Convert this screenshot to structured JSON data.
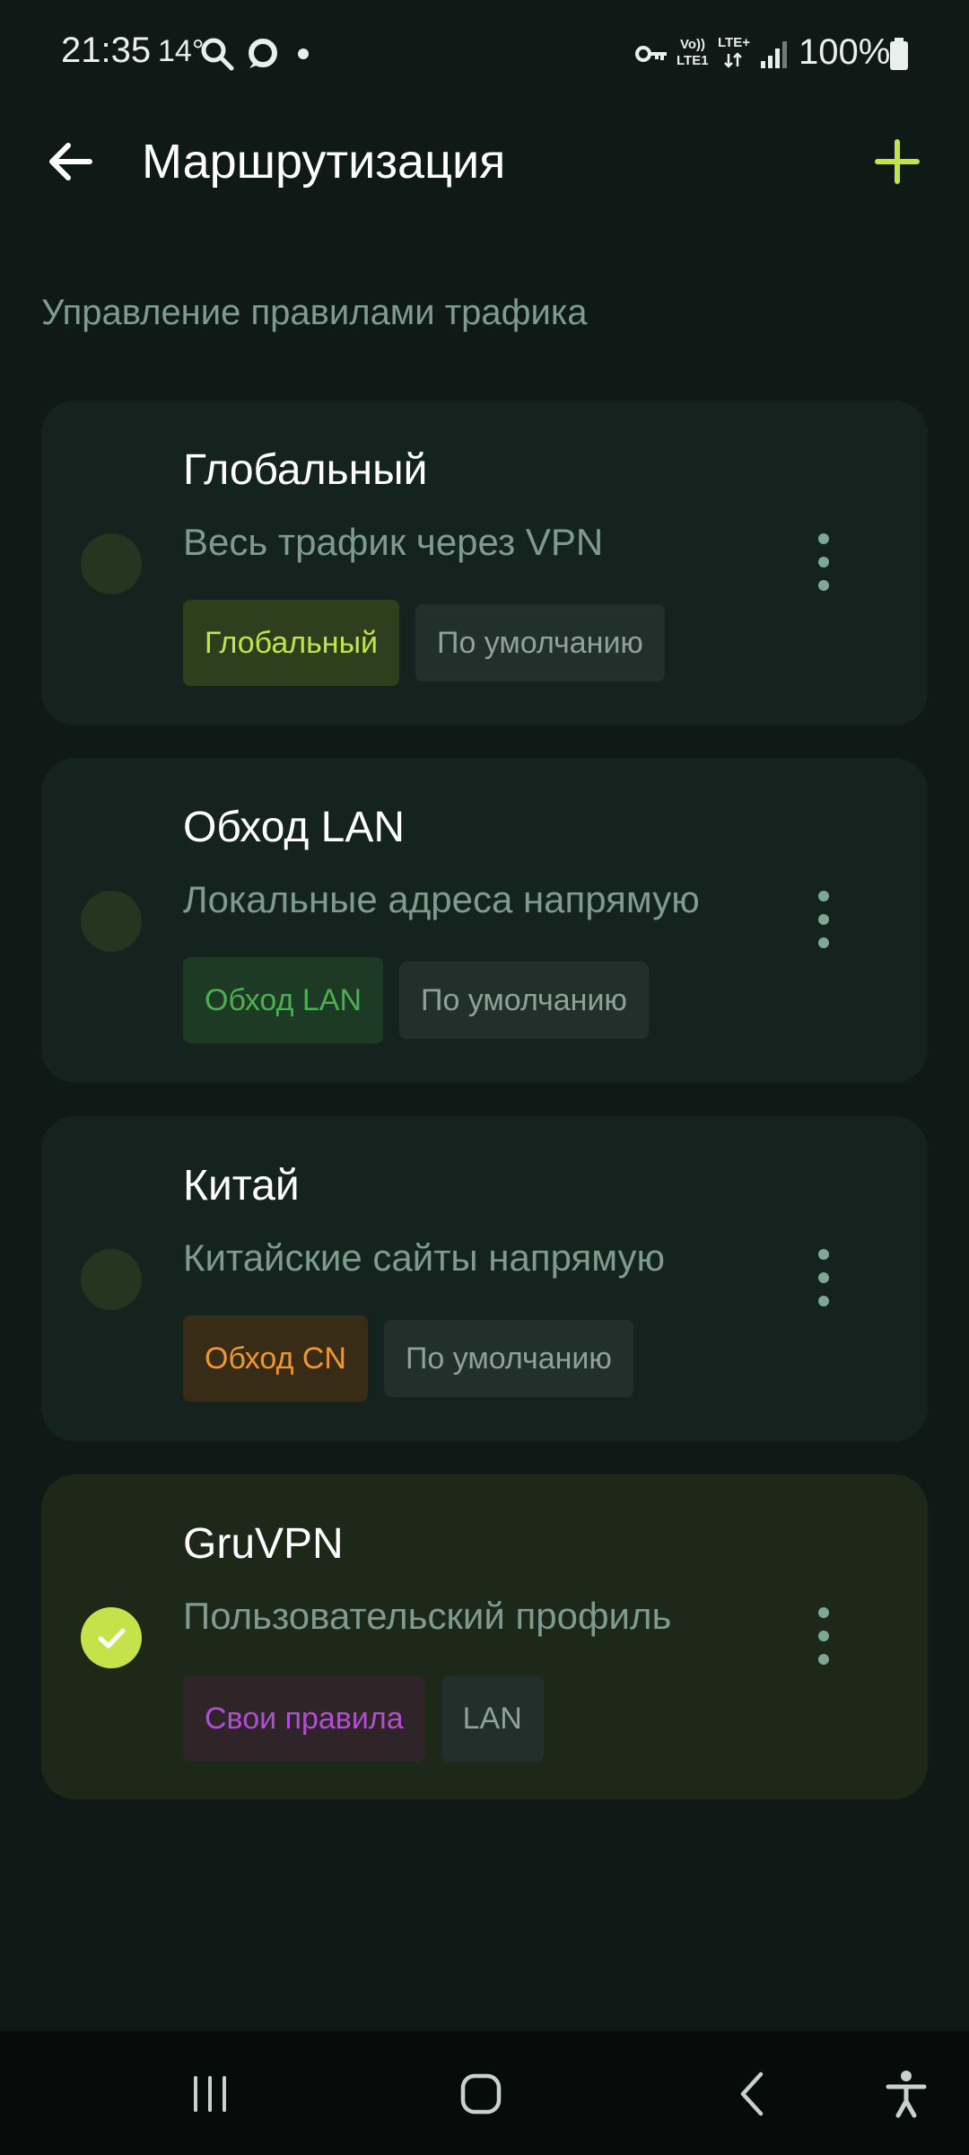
{
  "status_bar": {
    "time": "21:35",
    "temperature": "14°",
    "volte_top": "Vo))",
    "volte_bottom": "LTE1",
    "lte": "LTE+",
    "battery": "100%"
  },
  "app_bar": {
    "title": "Маршрутизация"
  },
  "subtitle": "Управление правилами трафика",
  "colors": {
    "accent": "#c6e24a",
    "background": "#0f1a17",
    "card": "#15231e",
    "card_active": "#1d2819"
  },
  "profiles": [
    {
      "title": "Глобальный",
      "description": "Весь трафик через VPN",
      "selected": false,
      "tags": [
        {
          "label": "Глобальный",
          "color": "#c6e24a",
          "bg": "#2d3f1c"
        },
        {
          "label": "По умолчанию",
          "color": "#8fa298",
          "bg": "#22302b"
        }
      ]
    },
    {
      "title": "Обход LAN",
      "description": "Локальные адреса напрямую",
      "selected": false,
      "tags": [
        {
          "label": "Обход LAN",
          "color": "#4caf50",
          "bg": "#1d3a25"
        },
        {
          "label": "По умолчанию",
          "color": "#8fa298",
          "bg": "#22302b"
        }
      ]
    },
    {
      "title": "Китай",
      "description": "Китайские сайты напрямую",
      "selected": false,
      "tags": [
        {
          "label": "Обход CN",
          "color": "#f0962d",
          "bg": "#392c16"
        },
        {
          "label": "По умолчанию",
          "color": "#8fa298",
          "bg": "#22302b"
        }
      ]
    },
    {
      "title": "GruVPN",
      "description": "Пользовательский профиль",
      "selected": true,
      "tags": [
        {
          "label": "Свои правила",
          "color": "#b04fd0",
          "bg": "#2f2428"
        },
        {
          "label": "LAN",
          "color": "#8fa298",
          "bg": "#22302b"
        }
      ]
    }
  ]
}
